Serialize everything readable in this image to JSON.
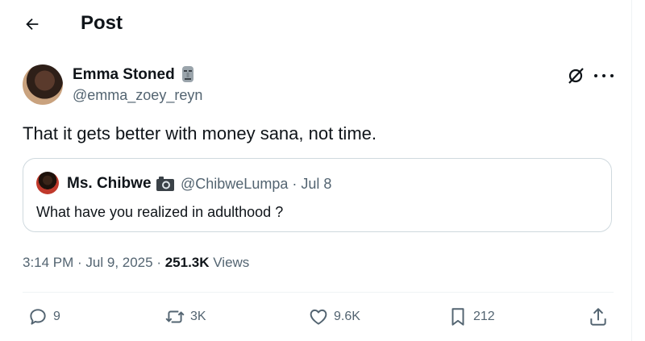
{
  "header": {
    "title": "Post"
  },
  "post": {
    "author": {
      "display_name": "Emma Stoned",
      "handle": "@emma_zoey_reyn"
    },
    "text": "That it gets better with money sana, not time.",
    "quote": {
      "display_name": "Ms. Chibwe",
      "handle_date": "@ChibweLumpa · Jul 8",
      "text": "What have you realized in adulthood ?"
    },
    "meta": {
      "time_date": "3:14 PM · Jul 9, 2025 · ",
      "views_count": "251.3K",
      "views_label": " Views"
    }
  },
  "actions": {
    "replies": "9",
    "reposts": "3K",
    "likes": "9.6K",
    "bookmarks": "212"
  },
  "colors": {
    "text": "#0f1419",
    "secondary": "#536471",
    "border": "#cfd9de"
  }
}
